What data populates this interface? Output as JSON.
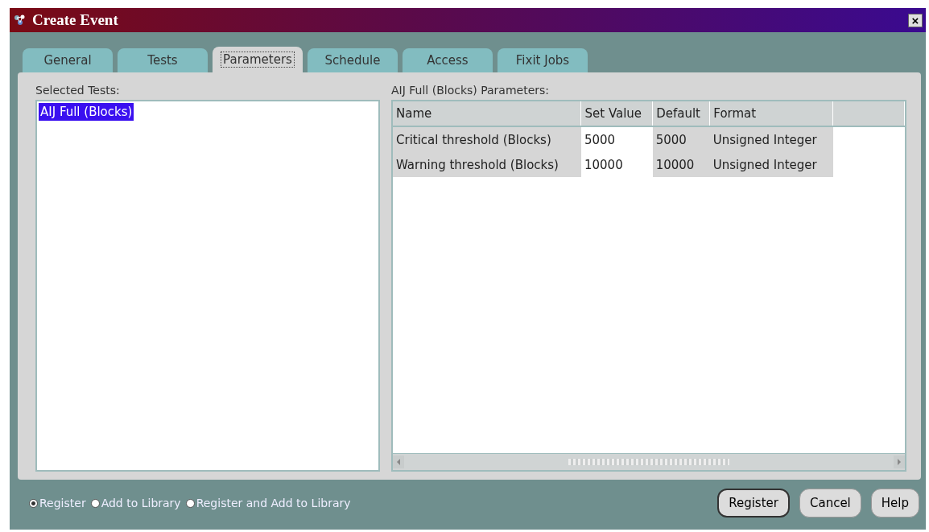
{
  "window": {
    "title": "Create Event",
    "close": "×"
  },
  "tabs": [
    {
      "label": "General",
      "selected": false
    },
    {
      "label": "Tests",
      "selected": false
    },
    {
      "label": "Parameters",
      "selected": true
    },
    {
      "label": "Schedule",
      "selected": false
    },
    {
      "label": "Access",
      "selected": false
    },
    {
      "label": "Fixit Jobs",
      "selected": false
    }
  ],
  "selected_tests": {
    "label": "Selected Tests:",
    "items": [
      {
        "label": "AIJ Full (Blocks)",
        "selected": true
      }
    ]
  },
  "parameters": {
    "label": "AIJ Full (Blocks) Parameters:",
    "columns": [
      {
        "label": "Name",
        "editable": false
      },
      {
        "label": "Set Value",
        "editable": true
      },
      {
        "label": "Default",
        "editable": false
      },
      {
        "label": "Format",
        "editable": false
      }
    ],
    "rows": [
      [
        "Critical threshold (Blocks)",
        "5000",
        "5000",
        "Unsigned Integer"
      ],
      [
        "Warning threshold (Blocks)",
        "10000",
        "10000",
        "Unsigned Integer"
      ]
    ]
  },
  "options": [
    {
      "label": "Register",
      "selected": true
    },
    {
      "label": "Add to Library",
      "selected": false
    },
    {
      "label": "Register and Add to Library",
      "selected": false
    }
  ],
  "buttons": [
    {
      "label": "Register",
      "default": true
    },
    {
      "label": "Cancel",
      "default": false
    },
    {
      "label": "Help",
      "default": false
    }
  ]
}
